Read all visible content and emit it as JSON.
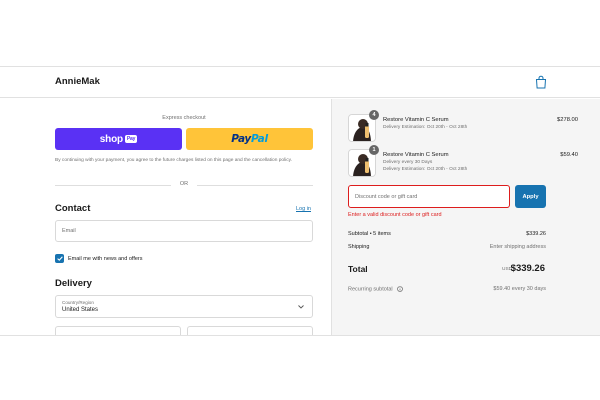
{
  "header": {
    "brand": "AnnieMak"
  },
  "express": {
    "label": "Express checkout",
    "shop_logo": "shop",
    "shop_pay": "Pay",
    "paypal_a": "Pay",
    "paypal_b": "Pal",
    "disclaimer": "By continuing with your payment, you agree to the future charges listed on this page and the cancellation policy.",
    "or": "OR"
  },
  "contact": {
    "title": "Contact",
    "login": "Log in",
    "email_placeholder": "Email",
    "news_label": "Email me with news and offers",
    "news_checked": true
  },
  "delivery": {
    "title": "Delivery",
    "country_label": "Country/Region",
    "country_value": "United States"
  },
  "cart": {
    "items": [
      {
        "qty": "4",
        "name": "Restore Vitamin C Serum",
        "line1": "Delivery Estimation: Oct 20th - Oct 28th",
        "line2": "",
        "price": "$278.00"
      },
      {
        "qty": "1",
        "name": "Restore Vitamin C Serum",
        "line1": "Delivery every 30 Days",
        "line2": "Delivery Estimation: Oct 20th - Oct 28th",
        "price": "$59.40"
      }
    ],
    "discount_placeholder": "Discount code or gift card",
    "apply": "Apply",
    "error": "Enter a valid discount code or gift card",
    "subtotal_label": "Subtotal • 5 items",
    "subtotal_value": "$339.26",
    "shipping_label": "Shipping",
    "shipping_value": "Enter shipping address",
    "total_label": "Total",
    "total_currency": "USD",
    "total_value": "$339.26",
    "recurring_label": "Recurring subtotal",
    "recurring_value": "$59.40 every 30 days"
  },
  "colors": {
    "accent": "#1773b0",
    "error": "#dd1d1d",
    "shop": "#5a31f4",
    "paypal": "#ffc439"
  }
}
